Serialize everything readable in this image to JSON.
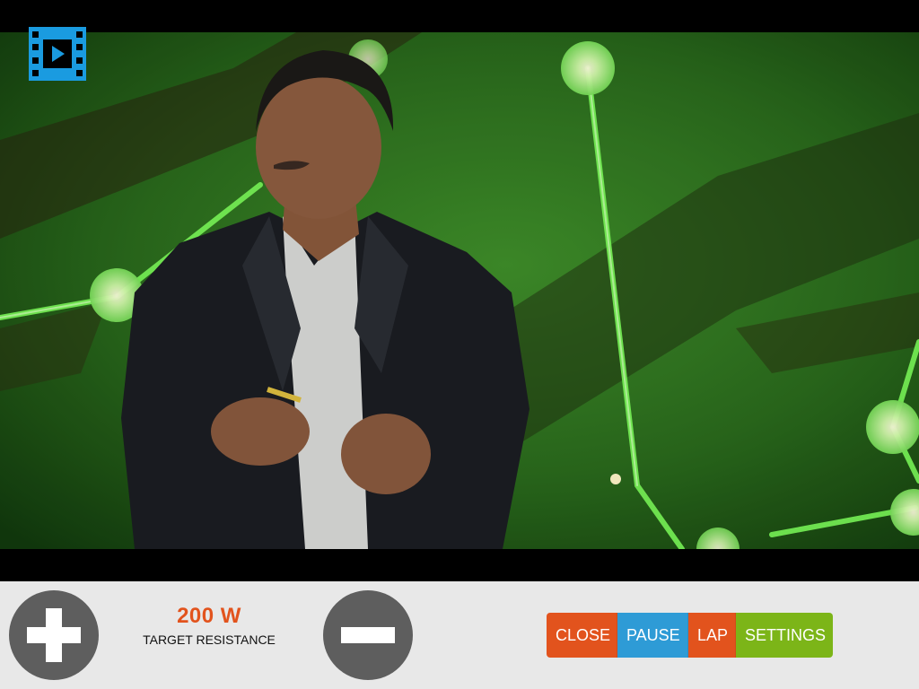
{
  "colors": {
    "accent_orange": "#e2531d",
    "accent_blue": "#2e9bd6",
    "accent_green": "#7cb518",
    "icon_blue": "#1a9be0",
    "control_gray": "#5e5e5e",
    "bar_background": "#e8e8e8"
  },
  "video": {
    "corner_icon": "film-play-icon"
  },
  "controls": {
    "increase_icon": "plus-icon",
    "decrease_icon": "minus-icon",
    "target_resistance": {
      "value": "200 W",
      "label": "TARGET RESISTANCE"
    },
    "buttons": {
      "close": "CLOSE",
      "pause": "PAUSE",
      "lap": "LAP",
      "settings": "SETTINGS"
    }
  }
}
